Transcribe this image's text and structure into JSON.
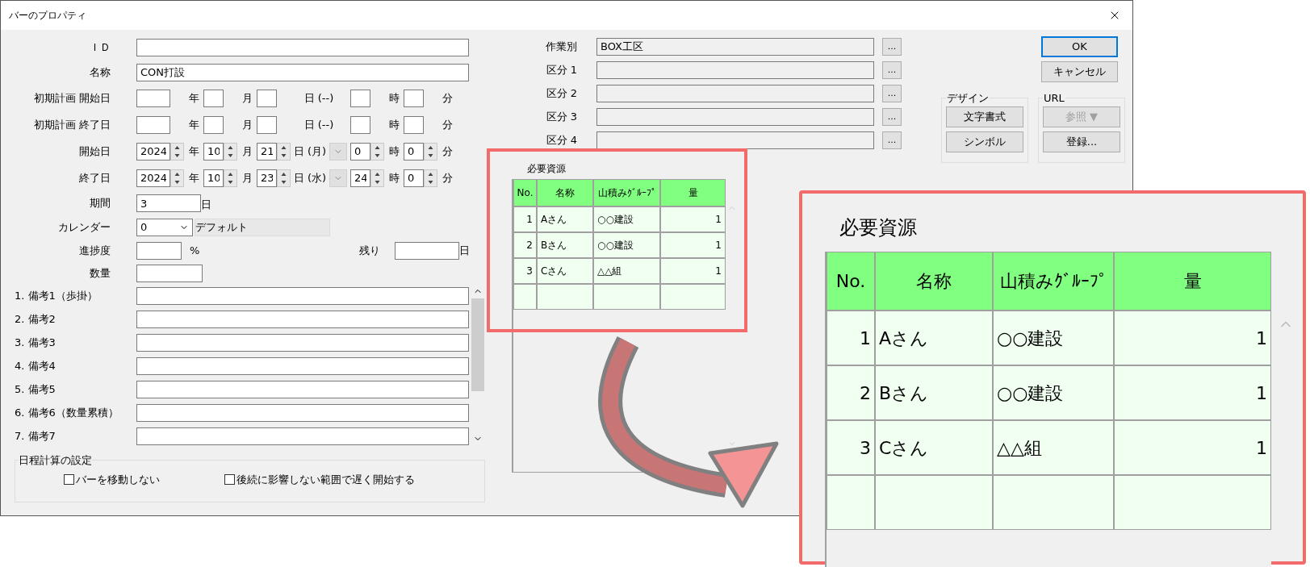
{
  "window": {
    "title": "バーのプロパティ"
  },
  "fields": [
    {
      "label": "ＩＤ"
    },
    {
      "label": "名称",
      "value": "CON打設"
    }
  ],
  "date_rows": [
    {
      "label": "初期計画 開始日",
      "kind": "blank",
      "parts": [
        {
          "unit": "年"
        },
        {
          "unit": "月"
        },
        {
          "unit": "日 (--)"
        },
        {
          "unit": "時"
        },
        {
          "unit": "分"
        }
      ]
    },
    {
      "label": "初期計画 終了日",
      "kind": "blank",
      "parts": [
        {
          "unit": "年"
        },
        {
          "unit": "月"
        },
        {
          "unit": "日 (--)"
        },
        {
          "unit": "時"
        },
        {
          "unit": "分"
        }
      ]
    },
    {
      "label": "開始日",
      "kind": "spin",
      "parts": [
        {
          "value": "2024",
          "unit": "年"
        },
        {
          "value": "10",
          "unit": "月"
        },
        {
          "value": "21",
          "unit": "日 (月)"
        },
        {
          "value": "0",
          "unit": "時"
        },
        {
          "value": "0",
          "unit": "分"
        }
      ]
    },
    {
      "label": "終了日",
      "kind": "spin",
      "parts": [
        {
          "value": "2024",
          "unit": "年"
        },
        {
          "value": "10",
          "unit": "月"
        },
        {
          "value": "23",
          "unit": "日 (水)"
        },
        {
          "value": "24",
          "unit": "時"
        },
        {
          "value": "0",
          "unit": "分"
        }
      ]
    }
  ],
  "duration": {
    "label": "期間",
    "value": "3",
    "unit": "日"
  },
  "calendar": {
    "label": "カレンダー",
    "value": "0",
    "name": "デフォルト"
  },
  "progress": {
    "label": "進捗度",
    "unit": "%",
    "remaining_label": "残り",
    "remaining_unit": "日"
  },
  "quantity": {
    "label": "数量"
  },
  "remarks": [
    "1. 備考1（歩掛）",
    "2. 備考2",
    "3. 備考3",
    "4. 備考4",
    "5. 備考5",
    "6. 備考6（数量累積）",
    "7. 備考7"
  ],
  "schedule_group": {
    "title": "日程計算の設定",
    "options": [
      {
        "label": "バーを移動しない",
        "checked": false
      },
      {
        "label": "後続に影響しない範囲で遅く開始する",
        "checked": false
      }
    ]
  },
  "classifications": [
    {
      "label": "作業別",
      "value": "BOX工区",
      "button": "..."
    },
    {
      "label": "区分 1",
      "button": "..."
    },
    {
      "label": "区分 2",
      "button": "..."
    },
    {
      "label": "区分 3",
      "button": "..."
    },
    {
      "label": "区分 4",
      "button": "..."
    }
  ],
  "resources": {
    "title": "必要資源",
    "columns": [
      "No.",
      "名称",
      "山積みｸﾞﾙｰﾌﾟ",
      "量"
    ],
    "rows": [
      [
        "1",
        "Aさん",
        "○○建設",
        "1"
      ],
      [
        "2",
        "Bさん",
        "○○建設",
        "1"
      ],
      [
        "3",
        "Cさん",
        "△△組",
        "1"
      ]
    ]
  },
  "buttons": [
    {
      "label": "OK",
      "default": true
    },
    {
      "label": "キャンセル",
      "default": false
    }
  ],
  "design_group": {
    "title": "デザイン",
    "buttons": [
      {
        "label": "文字書式",
        "disabled": false
      },
      {
        "label": "シンボル",
        "disabled": false
      }
    ]
  },
  "url_group": {
    "title": "URL",
    "buttons": [
      {
        "label": "参照 ▼",
        "disabled": true
      },
      {
        "label": "登録...",
        "disabled": false
      }
    ]
  },
  "callout": {
    "title": "必要資源",
    "columns": [
      "No.",
      "名称",
      "山積みｸﾞﾙｰﾌﾟ",
      "量"
    ],
    "rows": [
      [
        "1",
        "Aさん",
        "○○建設",
        "1"
      ],
      [
        "2",
        "Bさん",
        "○○建設",
        "1"
      ],
      [
        "3",
        "Cさん",
        "△△組",
        "1"
      ]
    ]
  }
}
